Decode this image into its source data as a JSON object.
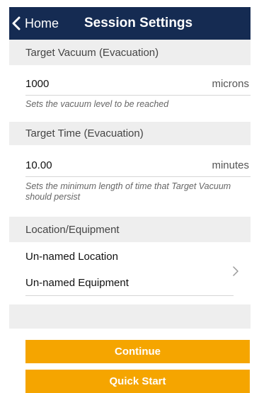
{
  "nav": {
    "back_label": "Home",
    "title": "Session Settings"
  },
  "vacuum": {
    "header": "Target Vacuum (Evacuation)",
    "value": "1000",
    "unit": "microns",
    "help": "Sets the vacuum level to be reached"
  },
  "time": {
    "header": "Target Time (Evacuation)",
    "value": "10.00",
    "unit": "minutes",
    "help": "Sets the minimum length of time that Target Vacuum should persist"
  },
  "location": {
    "header": "Location/Equipment",
    "location_name": "Un-named Location",
    "equipment_name": "Un-named Equipment"
  },
  "buttons": {
    "continue_label": "Continue",
    "quick_start_label": "Quick Start"
  },
  "colors": {
    "navbar": "#152b52",
    "accent": "#f5a500",
    "section_bg": "#eeeeee"
  },
  "icons": {
    "back": "chevron-left-icon",
    "disclosure": "chevron-right-icon"
  }
}
